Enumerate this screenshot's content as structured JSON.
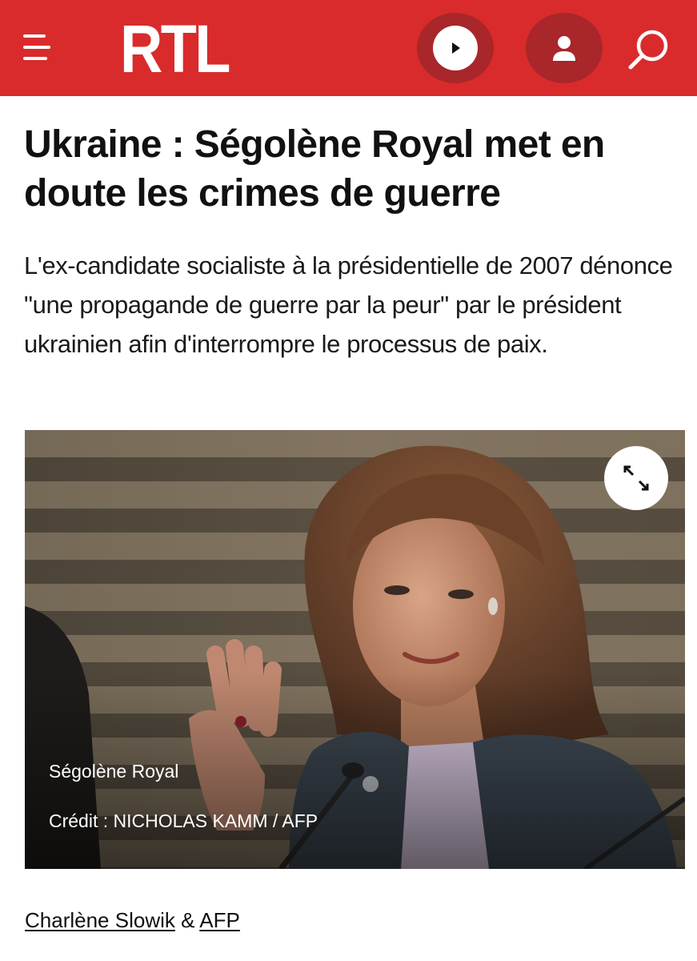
{
  "header": {
    "logo_text": "RTL",
    "brand_color": "#d92b2b",
    "button_dark_color": "#a9262a",
    "icons": {
      "menu": "hamburger-menu-icon",
      "play": "play-icon",
      "account": "user-icon",
      "search": "search-icon"
    }
  },
  "article": {
    "headline": "Ukraine : Ségolène Royal met en doute les crimes de guerre",
    "lead": "L'ex-candidate socialiste à la présidentielle de 2007 dénonce \"une propagande de guerre par la peur\" par le président ukrainien afin d'interrompre le processus de paix.",
    "photo": {
      "caption": "Ségolène Royal",
      "credit": "Crédit : NICHOLAS KAMM / AFP",
      "expand_icon": "expand-icon"
    },
    "byline": {
      "author": "Charlène Slowik",
      "separator": " & ",
      "agency": "AFP"
    }
  }
}
